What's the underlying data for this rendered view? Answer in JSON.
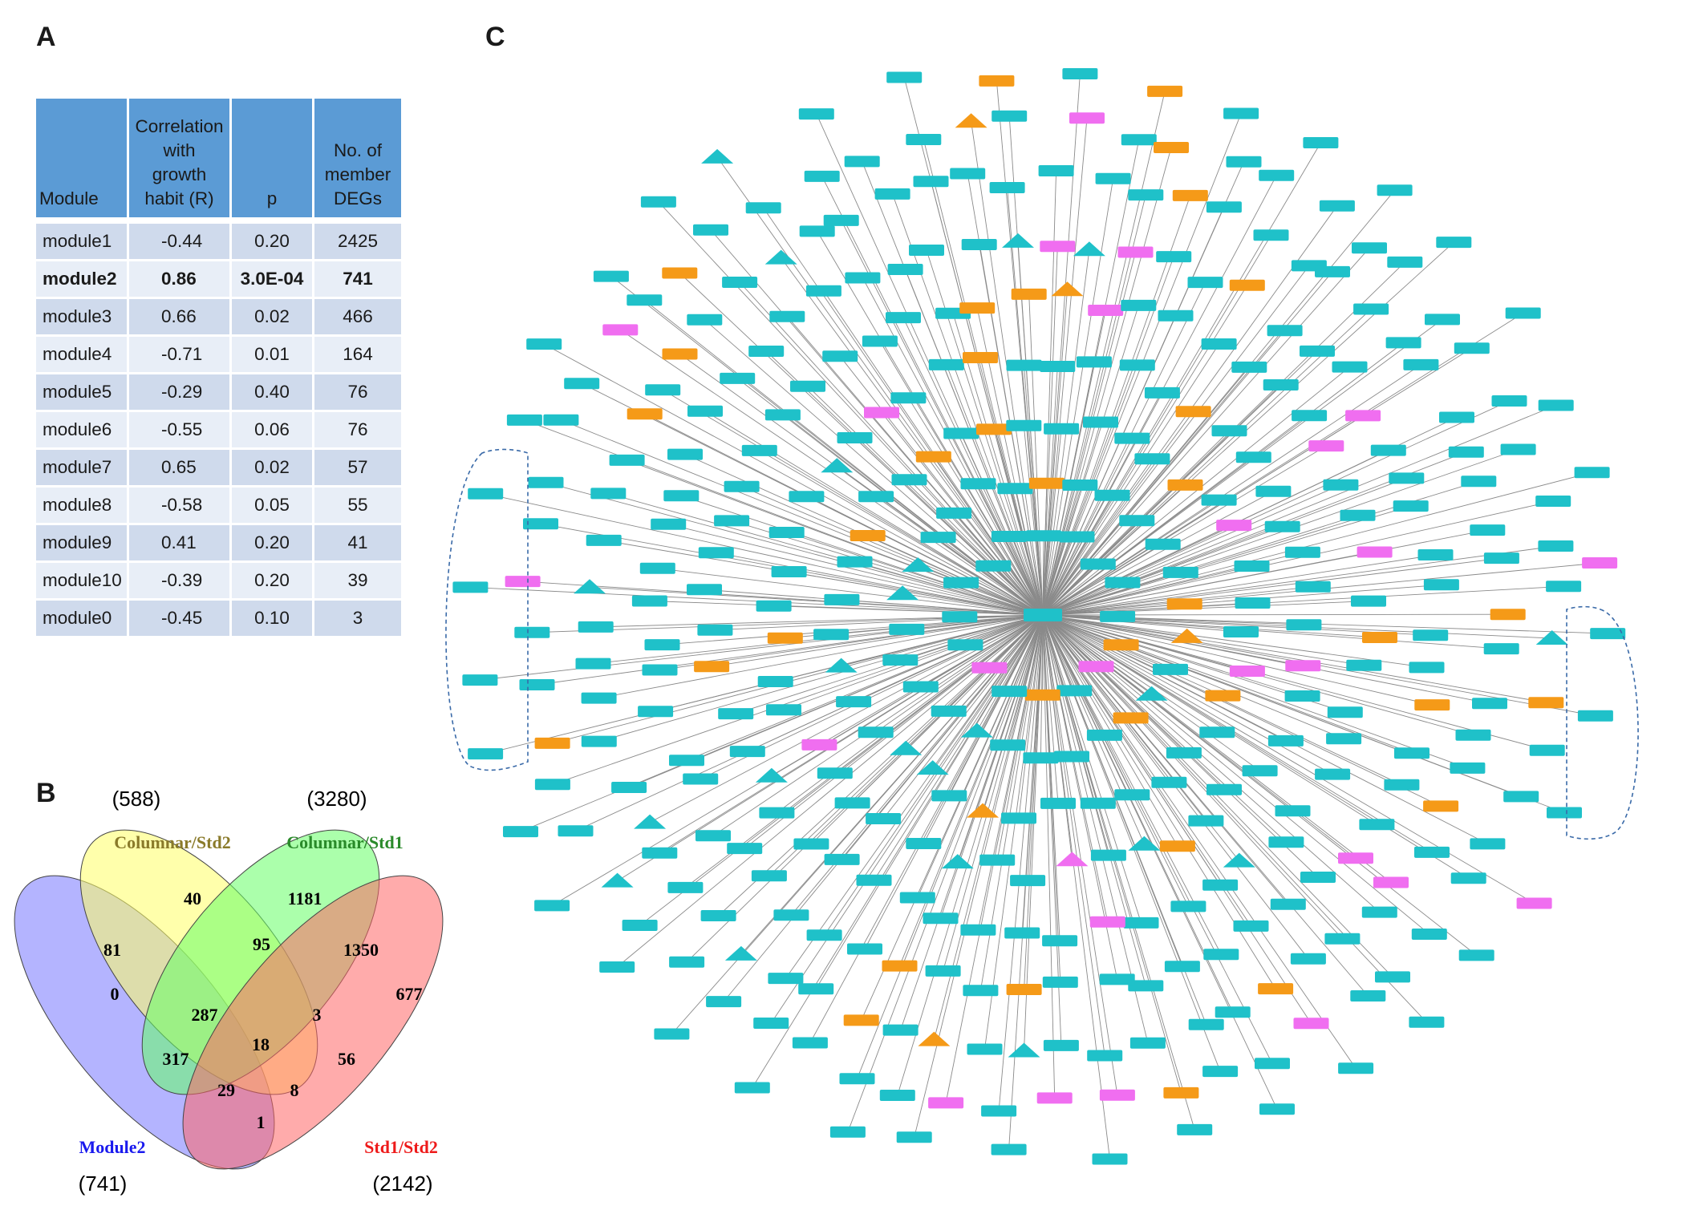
{
  "panel_a": {
    "letter": "A",
    "headers": [
      "Module",
      "Correlation with growth habit (R)",
      "p",
      "No. of member DEGs"
    ],
    "header_lines": [
      [
        "Module"
      ],
      [
        "Correlation",
        "with",
        "growth",
        "habit (R)"
      ],
      [
        "p"
      ],
      [
        "No. of",
        "member",
        "DEGs"
      ]
    ],
    "rows": [
      {
        "module": "module1",
        "r": "-0.44",
        "p": "0.20",
        "degs": "2425",
        "bold": false
      },
      {
        "module": "module2",
        "r": "0.86",
        "p": "3.0E-04",
        "degs": "741",
        "bold": true
      },
      {
        "module": "module3",
        "r": "0.66",
        "p": "0.02",
        "degs": "466",
        "bold": false
      },
      {
        "module": "module4",
        "r": "-0.71",
        "p": "0.01",
        "degs": "164",
        "bold": false
      },
      {
        "module": "module5",
        "r": "-0.29",
        "p": "0.40",
        "degs": "76",
        "bold": false
      },
      {
        "module": "module6",
        "r": "-0.55",
        "p": "0.06",
        "degs": "76",
        "bold": false
      },
      {
        "module": "module7",
        "r": "0.65",
        "p": "0.02",
        "degs": "57",
        "bold": false
      },
      {
        "module": "module8",
        "r": "-0.58",
        "p": "0.05",
        "degs": "55",
        "bold": false
      },
      {
        "module": "module9",
        "r": "0.41",
        "p": "0.20",
        "degs": "41",
        "bold": false
      },
      {
        "module": "module10",
        "r": "-0.39",
        "p": "0.20",
        "degs": "39",
        "bold": false
      },
      {
        "module": "module0",
        "r": "-0.45",
        "p": "0.10",
        "degs": "3",
        "bold": false
      }
    ],
    "colors": {
      "header": "#5b9bd5",
      "row_odd": "#cfdaec",
      "row_even": "#e8eef7"
    }
  },
  "panel_b": {
    "letter": "B",
    "sets": [
      {
        "name": "Columnar/Std2",
        "total": "(588)",
        "color": "#ffff66",
        "label_color": "#8a7a2a"
      },
      {
        "name": "Columnar/Std1",
        "total": "(3280)",
        "color": "#66ff66",
        "label_color": "#2a8a2a"
      },
      {
        "name": "Module2",
        "total": "(741)",
        "color": "#7777ff",
        "label_color": "#1a1aee"
      },
      {
        "name": "Std1/Std2",
        "total": "(2142)",
        "color": "#ff6666",
        "label_color": "#ee1a1a"
      }
    ],
    "regions": {
      "s2_only": "40",
      "s1_only": "1181",
      "m2_only": "0",
      "std_only": "677",
      "m2_s2": "81",
      "s2_s1": "95",
      "s1_std": "1350",
      "m2_s2_s1": "287",
      "s2_s1_std": "3",
      "all": "18",
      "m2_s1": "317",
      "s2_std": "56",
      "m2_s1_std": "29",
      "m2_s2_std": "8",
      "m2_std": "1"
    }
  },
  "panel_c": {
    "letter": "C",
    "colors": {
      "node_default": "#1fc1c9",
      "node_alt1": "#f59a18",
      "node_alt2": "#f06ef0",
      "edge": "#8a8a8a",
      "group_outline": "#3a6aa8"
    }
  }
}
